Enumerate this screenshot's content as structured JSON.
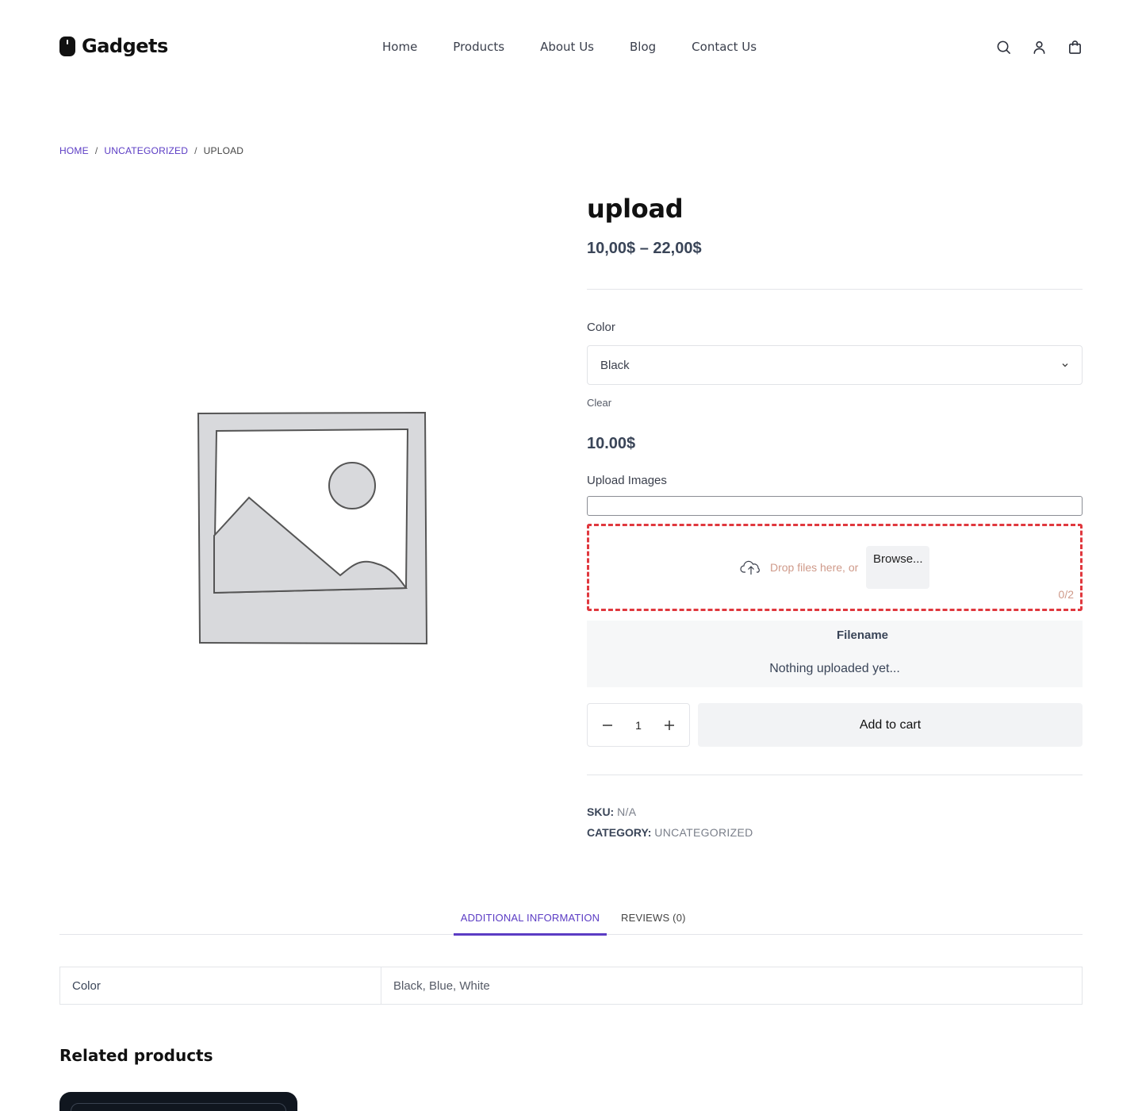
{
  "header": {
    "logo_text": "Gadgets",
    "nav": [
      "Home",
      "Products",
      "About Us",
      "Blog",
      "Contact Us"
    ],
    "icons": [
      "search-icon",
      "account-icon",
      "cart-icon"
    ]
  },
  "breadcrumb": {
    "home": "HOME",
    "separator": "/",
    "category": "UNCATEGORIZED",
    "current": "UPLOAD"
  },
  "product": {
    "title": "upload",
    "price_range": "10,00$ – 22,00$",
    "color_label": "Color",
    "color_selected": "Black",
    "clear_label": "Clear",
    "variation_price": "10.00$",
    "upload_label": "Upload Images",
    "drop_text": "Drop files here, or",
    "browse_label": "Browse...",
    "upload_counter": "0/2",
    "filename_header": "Filename",
    "nothing_uploaded": "Nothing uploaded yet...",
    "quantity": "1",
    "add_to_cart": "Add to cart",
    "sku_label": "SKU:",
    "sku_value": "N/A",
    "category_label": "CATEGORY:",
    "category_value": "UNCATEGORIZED"
  },
  "tabs": {
    "additional": "ADDITIONAL INFORMATION",
    "reviews": "REVIEWS (0)"
  },
  "attributes": {
    "name": "Color",
    "value": "Black, Blue, White"
  },
  "related": {
    "title": "Related products"
  },
  "colors": {
    "accent": "#5b3cc4",
    "dropzone_border": "#e0383e"
  }
}
